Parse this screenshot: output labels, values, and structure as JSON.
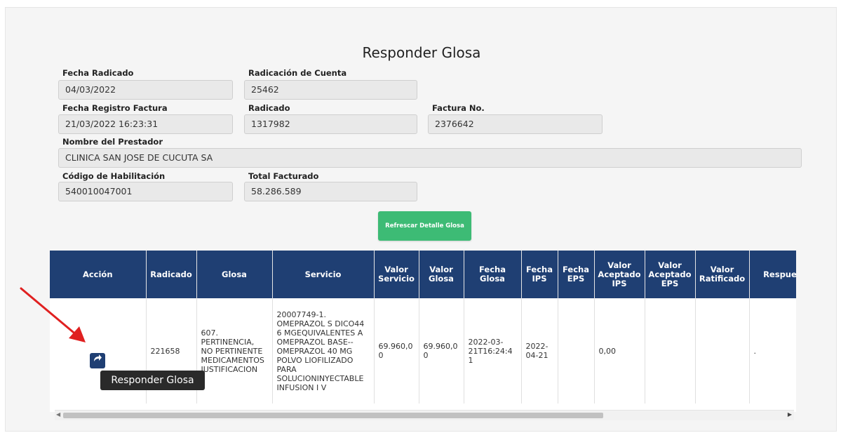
{
  "page": {
    "title": "Responder Glosa"
  },
  "form": {
    "fecha_radicado": {
      "label": "Fecha Radicado",
      "value": "04/03/2022"
    },
    "radicacion_cuenta": {
      "label": "Radicación de Cuenta",
      "value": "25462"
    },
    "fecha_registro_factura": {
      "label": "Fecha Registro Factura",
      "value": "21/03/2022 16:23:31"
    },
    "radicado": {
      "label": "Radicado",
      "value": "1317982"
    },
    "factura_no": {
      "label": "Factura No.",
      "value": "2376642"
    },
    "nombre_prestador": {
      "label": "Nombre del Prestador",
      "value": "CLINICA SAN JOSE DE CUCUTA SA"
    },
    "codigo_habilitacion": {
      "label": "Código de Habilitación",
      "value": "540010047001"
    },
    "total_facturado": {
      "label": "Total Facturado",
      "value": "58.286.589"
    }
  },
  "refresh_button": {
    "label": "Refrescar Detalle Glosa"
  },
  "table": {
    "headers": {
      "accion": "Acción",
      "radicado": "Radicado",
      "glosa": "Glosa",
      "servicio": "Servicio",
      "valor_servicio": "Valor Servicio",
      "valor_glosa": "Valor Glosa",
      "fecha_glosa": "Fecha Glosa",
      "fecha_ips": "Fecha IPS",
      "fecha_eps": "Fecha EPS",
      "valor_aceptado_ips": "Valor Aceptado IPS",
      "valor_aceptado_eps": "Valor Aceptado EPS",
      "valor_ratificado": "Valor Ratificado",
      "respuesta_ips": "Respuesta IPS"
    },
    "rows": [
      {
        "radicado": "221658",
        "glosa": "607. PERTINENCIA, NO PERTINENTE MEDICAMENTOS JUSTIFICACION",
        "servicio": "20007749-1. OMEPRAZOL S DICO44 6 MGEQUIVALENTES A OMEPRAZOL BASE-- OMEPRAZOL 40 MG POLVO LIOFILIZADO PARA SOLUCIONINYECTABLE INFUSION I V",
        "valor_servicio": "69.960,00",
        "valor_glosa": "69.960,00",
        "fecha_glosa": "2022-03-21T16:24:41",
        "fecha_ips": "2022-04-21",
        "fecha_eps": "",
        "valor_aceptado_ips": "0,00",
        "valor_aceptado_eps": "",
        "valor_ratificado": "",
        "respuesta_ips": "."
      }
    ]
  },
  "tooltip": {
    "text": "Responder Glosa"
  },
  "icons": {
    "action": "reply-arrow-icon",
    "pointer": "red-arrow-icon"
  },
  "colors": {
    "header_bg": "#1f3f73",
    "refresh_button": "#3dbb75",
    "pointer": "#e02020"
  }
}
